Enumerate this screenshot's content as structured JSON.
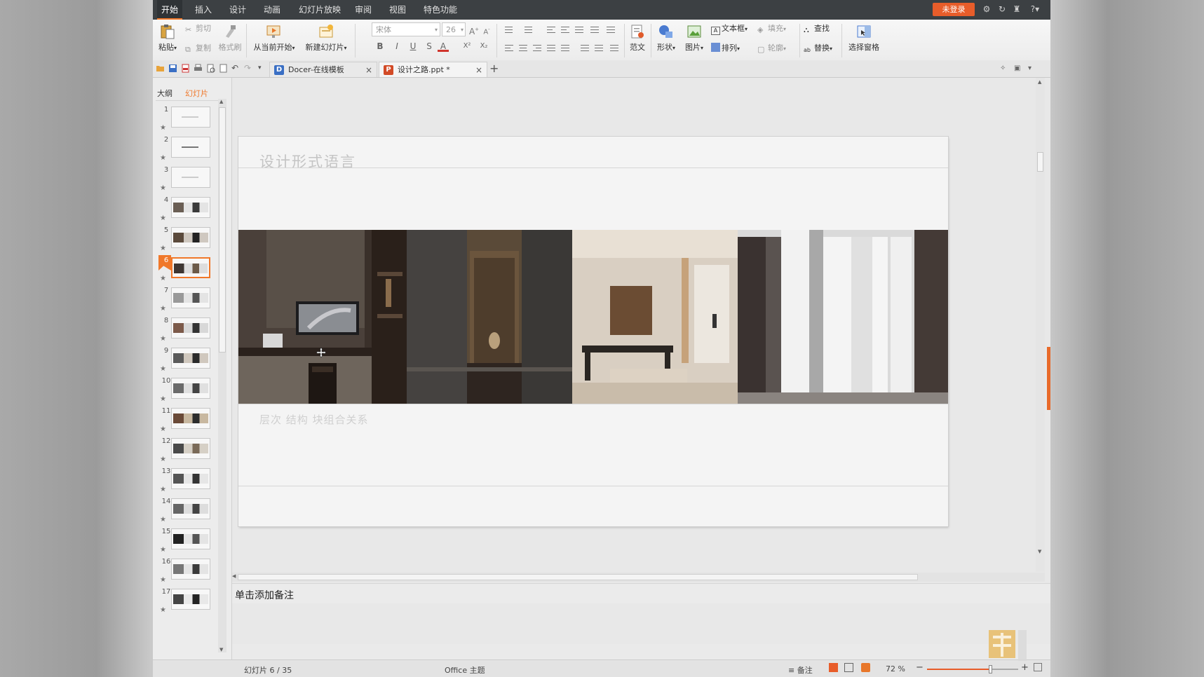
{
  "colors": {
    "accent": "#f0782a",
    "login": "#e85d2a",
    "menubar": "#3c4043"
  },
  "menubar": {
    "items": [
      "开始",
      "插入",
      "设计",
      "动画",
      "幻灯片放映",
      "审阅",
      "视图",
      "特色功能"
    ],
    "login_label": "未登录"
  },
  "ribbon": {
    "clipboard": {
      "paste": "粘贴",
      "cut": "剪切",
      "copy": "复制",
      "format_painter": "格式刷"
    },
    "slides": {
      "from_current": "从当前开始",
      "new_slide": "新建幻灯片"
    },
    "font": {
      "family": "宋体",
      "size": "26"
    },
    "format_buttons": [
      "B",
      "I",
      "U",
      "S",
      "A",
      "X²",
      "X₂"
    ],
    "template": "范文",
    "shape": "形状",
    "picture": "图片",
    "textbox": "文本框",
    "arrange": "排列",
    "fill": "填充",
    "outline": "轮廓",
    "find": "查找",
    "replace": "替换",
    "select_pane": "选择窗格"
  },
  "tabs": [
    {
      "label": "Docer-在线模板",
      "badge": "D",
      "icon": "docer-icon"
    },
    {
      "label": "设计之路.ppt *",
      "badge": "P",
      "icon": "ppt-icon"
    }
  ],
  "left_panel": {
    "tabs": [
      "大纲",
      "幻灯片"
    ],
    "active_tab": 1,
    "slide_numbers": [
      "1",
      "2",
      "3",
      "4",
      "5",
      "6",
      "7",
      "8",
      "9",
      "10",
      "11",
      "12",
      "13",
      "14",
      "15",
      "16",
      "17"
    ],
    "active_slide": 6
  },
  "slide": {
    "title": "设计形式语言",
    "subtitle": "层次 结构 块组合关系"
  },
  "notes_placeholder": "单击添加备注",
  "status": {
    "slide_counter": "幻灯片 6 / 35",
    "theme": "Office 主题",
    "notes_label": "备注",
    "zoom": "72 %",
    "zoom_fraction": 0.72
  }
}
